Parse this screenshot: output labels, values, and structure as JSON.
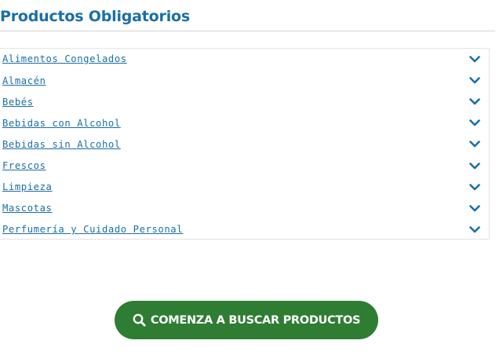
{
  "section": {
    "title": "Productos Obligatorios"
  },
  "categories": [
    {
      "label": "Alimentos Congelados",
      "icon": "chevron-down-icon"
    },
    {
      "label": "Almacén",
      "icon": "chevron-down-icon"
    },
    {
      "label": "Bebés",
      "icon": "chevron-down-icon"
    },
    {
      "label": "Bebidas con Alcohol",
      "icon": "chevron-down-icon"
    },
    {
      "label": "Bebidas sin Alcohol",
      "icon": "chevron-down-icon"
    },
    {
      "label": "Frescos",
      "icon": "chevron-down-icon"
    },
    {
      "label": "Limpieza",
      "icon": "chevron-down-icon"
    },
    {
      "label": "Mascotas",
      "icon": "chevron-down-icon"
    },
    {
      "label": "Perfumería y Cuidado Personal",
      "icon": "chevron-down-icon"
    }
  ],
  "cta": {
    "label": "COMENZA A BUSCAR PRODUCTOS",
    "icon": "search-icon"
  },
  "colors": {
    "link": "#1a6fa8",
    "cta_background": "#2e7d32",
    "cta_text": "#ffffff"
  }
}
